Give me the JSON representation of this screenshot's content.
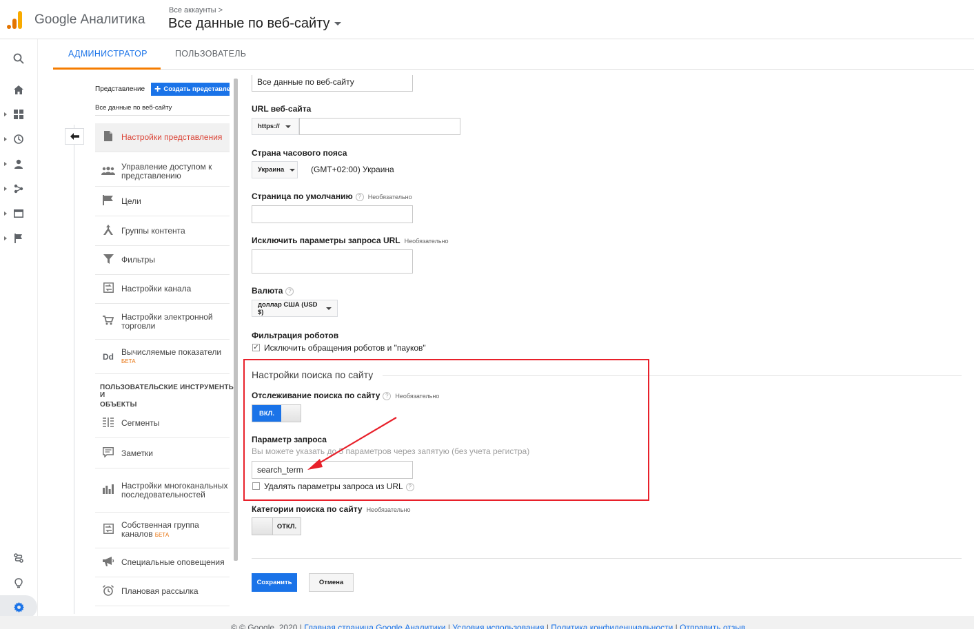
{
  "header": {
    "brand": "Google Аналитика",
    "breadcrumb": "Все аккаунты >",
    "property_title": "Все данные по веб-сайту"
  },
  "tabs": [
    {
      "label": "АДМИНИСТРАТОР",
      "active": true
    },
    {
      "label": "ПОЛЬЗОВАТЕЛЬ",
      "active": false
    }
  ],
  "view_column": {
    "view_label": "Представление",
    "create_button": "Создать представление",
    "view_name": "Все данные по веб-сайту",
    "menu": [
      {
        "label": "Настройки представления",
        "icon": "document-icon",
        "active": true
      },
      {
        "label": "Управление доступом к представлению",
        "icon": "people-icon"
      },
      {
        "label": "Цели",
        "icon": "flag-icon"
      },
      {
        "label": "Группы контента",
        "icon": "content-group-icon"
      },
      {
        "label": "Фильтры",
        "icon": "filter-icon"
      },
      {
        "label": "Настройки канала",
        "icon": "channel-icon"
      },
      {
        "label": "Настройки электронной торговли",
        "icon": "cart-icon"
      },
      {
        "label": "Вычисляемые показатели",
        "badge": "БЕТА",
        "icon": "dd-icon"
      }
    ],
    "section_heading_1": "ПОЛЬЗОВАТЕЛЬСКИЕ ИНСТРУМЕНТЫ И",
    "section_heading_2": "ОБЪЕКТЫ",
    "tools": [
      {
        "label": "Сегменты",
        "icon": "segments-icon"
      },
      {
        "label": "Заметки",
        "icon": "notes-icon"
      },
      {
        "label": "Настройки многоканальных последовательностей",
        "icon": "bar-chart-icon"
      },
      {
        "label": "Собственная группа каналов",
        "badge": "БЕТА",
        "icon": "custom-channel-icon"
      },
      {
        "label": "Специальные оповещения",
        "icon": "megaphone-icon"
      },
      {
        "label": "Плановая рассылка",
        "icon": "alarm-clock-icon"
      }
    ]
  },
  "form": {
    "view_name_value": "Все данные по веб-сайту",
    "url_label": "URL веб-сайта",
    "url_protocol": "https://",
    "url_value": "",
    "timezone_label": "Страна часового пояса",
    "timezone_country": "Украина",
    "timezone_value": "(GMT+02:00) Украина",
    "default_page_label": "Страница по умолчанию",
    "optional": "Необязательно",
    "exclude_params_label": "Исключить параметры запроса URL",
    "currency_label": "Валюта",
    "currency_value": "доллар США (USD $)",
    "bot_filter_label": "Фильтрация роботов",
    "bot_filter_checkbox": "Исключить обращения роботов и \"пауков\"",
    "site_search_section": "Настройки поиска по сайту",
    "site_search_tracking_label": "Отслеживание поиска по сайту",
    "toggle_on": "ВКЛ.",
    "query_param_label": "Параметр запроса",
    "query_param_hint": "Вы можете указать до 5 параметров через запятую (без учета регистра)",
    "query_param_value": "search_term",
    "strip_params_checkbox": "Удалять параметры запроса из URL",
    "search_categories_label": "Категории поиска по сайту",
    "toggle_off": "ОТКЛ.",
    "save": "Сохранить",
    "cancel": "Отмена",
    "help_glyph": "?"
  },
  "footer": {
    "copyright": "© © Google, 2020 |",
    "links": [
      "Главная страница Google Аналитики",
      "Условия использования",
      "Политика конфиденциальности",
      "Отправить отзыв"
    ]
  },
  "colors": {
    "accent": "#1a73e8",
    "active_tab_underline": "#f57c00",
    "annotation": "#e8202a"
  }
}
